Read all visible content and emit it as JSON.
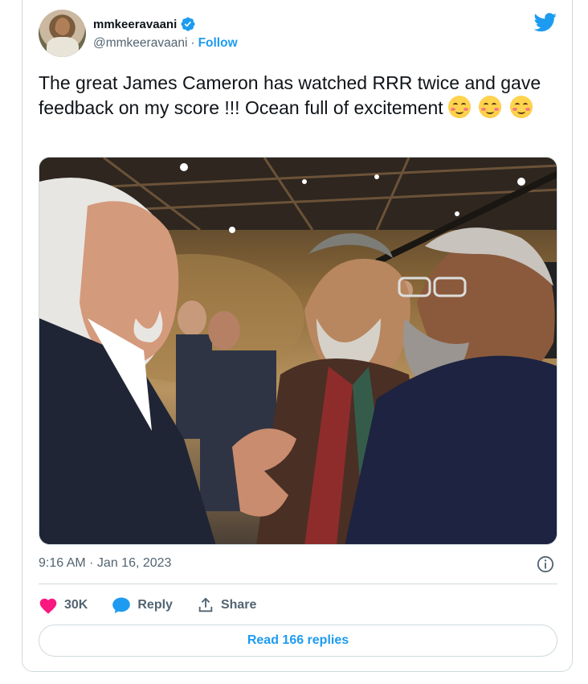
{
  "author": {
    "display_name": "mmkeeravaani",
    "handle": "@mmkeeravaani",
    "separator": "·",
    "follow_label": "Follow",
    "verified": true
  },
  "tweet": {
    "text": "The great James Cameron has watched RRR twice and gave feedback on my score !!! Ocean full of excitement",
    "emoji_icon": "smiling-face-with-smiling-eyes-emoji",
    "timestamp": "9:16 AM · Jan 16, 2023"
  },
  "actions": {
    "like_count": "30K",
    "reply_label": "Reply",
    "share_label": "Share"
  },
  "read_replies_label": "Read 166 replies",
  "colors": {
    "accent": "#1d9bf0",
    "like": "#f91880",
    "text": "#0f1419",
    "muted": "#536471",
    "border": "#cfd9de"
  }
}
